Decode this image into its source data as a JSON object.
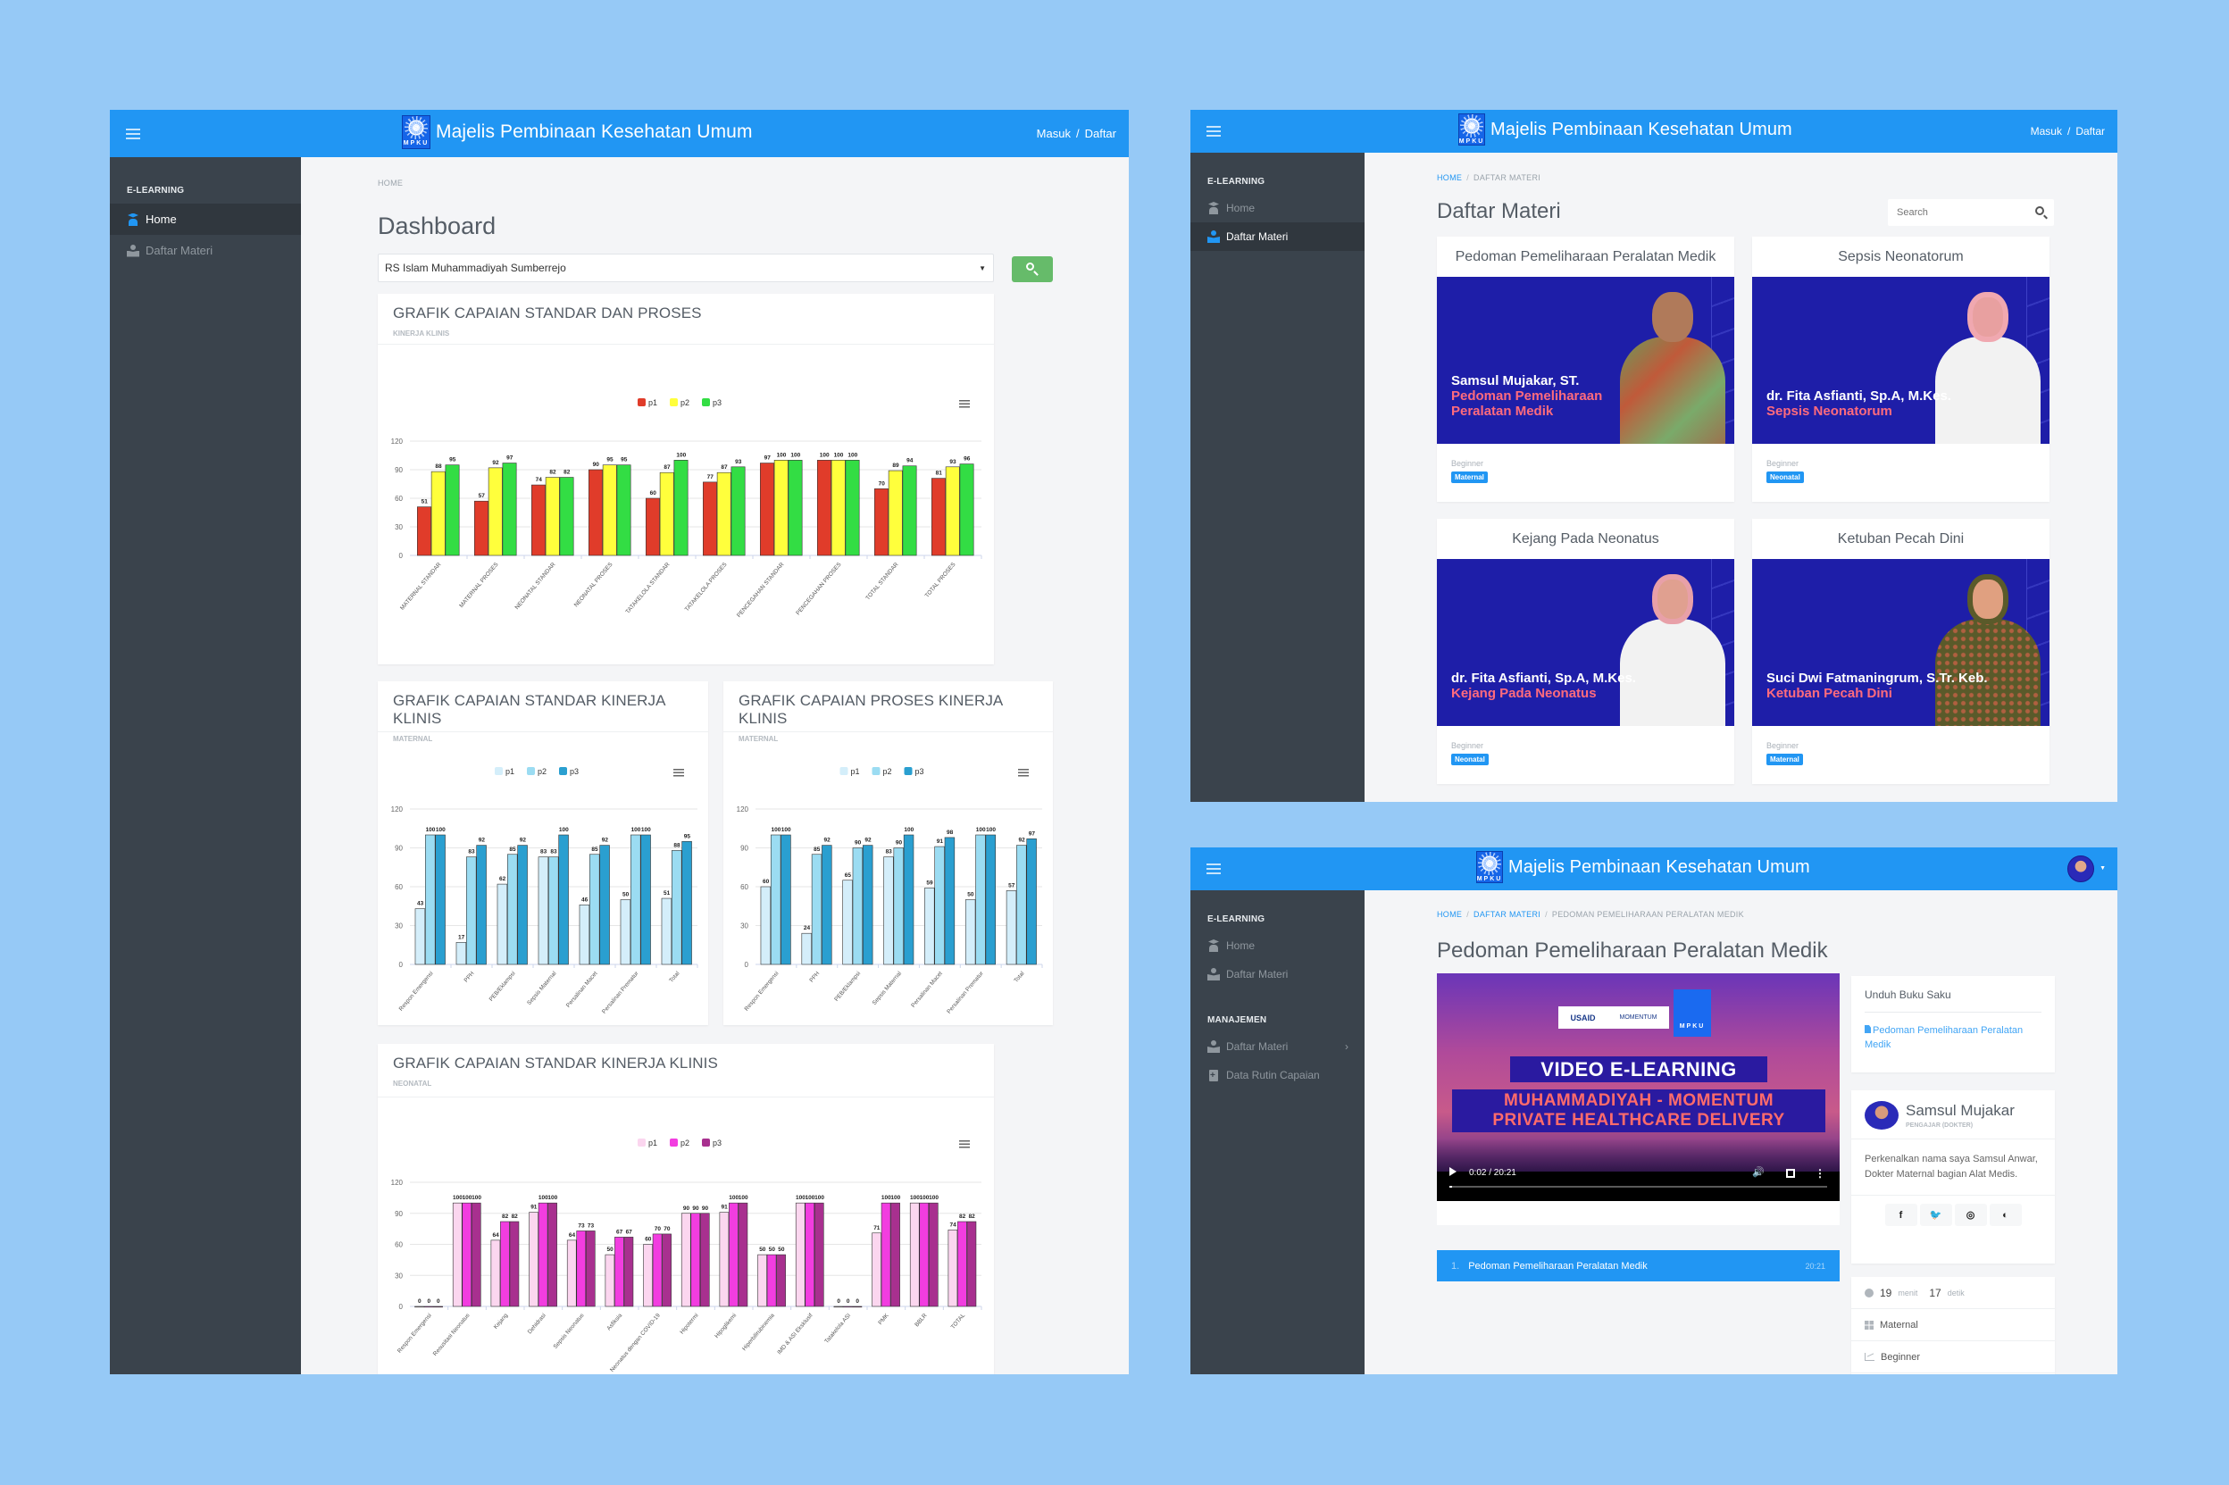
{
  "app": {
    "title": "Majelis Pembinaan Kesehatan Umum",
    "logo_text": "MPKU",
    "login_label": "Masuk",
    "register_label": "Daftar",
    "auth_separator": "/"
  },
  "dashboard": {
    "sidebar": {
      "section": "E-LEARNING",
      "items": [
        {
          "label": "Home",
          "icon": "graduate-icon",
          "active": true
        },
        {
          "label": "Daftar Materi",
          "icon": "book-reader-icon",
          "active": false
        }
      ]
    },
    "breadcrumb": [
      "HOME"
    ],
    "page_title": "Dashboard",
    "hospital_select": {
      "value": "RS Islam Muhammadiyah Sumberrejo"
    },
    "search_button_icon": "search-icon",
    "colors": {
      "primary": "#2196f3",
      "sidebar": "#3a434c",
      "success": "#66bb6a"
    }
  },
  "chart_data": [
    {
      "type": "bar",
      "title": "GRAFIK CAPAIAN STANDAR DAN PROSES",
      "subtitle": "KINERJA KLINIS",
      "categories": [
        "MATERNAL STANDAR",
        "MATERNAL PROSES",
        "NEONATAL STANDAR",
        "NEONATAL PROSES",
        "TATAKELOLA STANDAR",
        "TATAKELOLA PROSES",
        "PENCEGAHAN STANDAR",
        "PENCEGAHAN PROSES",
        "TOTAL STANDAR",
        "TOTAL PROSES"
      ],
      "series": [
        {
          "name": "p1",
          "color": "#e03c2a",
          "values": [
            51,
            57,
            74,
            90,
            60,
            77,
            97,
            100,
            70,
            81
          ]
        },
        {
          "name": "p2",
          "color": "#ffff3c",
          "values": [
            88,
            92,
            82,
            95,
            87,
            87,
            100,
            100,
            89,
            93
          ]
        },
        {
          "name": "p3",
          "color": "#33dd44",
          "values": [
            95,
            97,
            82,
            95,
            100,
            93,
            100,
            100,
            94,
            96
          ]
        }
      ],
      "yticks": [
        0,
        30,
        60,
        90,
        120
      ],
      "ylim": [
        0,
        120
      ],
      "legend": "top-center",
      "grid": true,
      "xlabel": "",
      "ylabel": ""
    },
    {
      "type": "bar",
      "title": "GRAFIK CAPAIAN STANDAR KINERJA KLINIS",
      "subtitle": "MATERNAL",
      "categories": [
        "Respon Emergensi",
        "PPH",
        "PEB/Eklampsi",
        "Sepsis Maternal",
        "Persalinan Macet",
        "Persalinan Prematur",
        "Total"
      ],
      "series": [
        {
          "name": "p1",
          "color": "#d4eefa",
          "values": [
            43,
            17,
            62,
            83,
            46,
            50,
            51
          ]
        },
        {
          "name": "p2",
          "color": "#9bdcf2",
          "values": [
            100,
            83,
            85,
            83,
            85,
            100,
            88
          ]
        },
        {
          "name": "p3",
          "color": "#2a9fd0",
          "values": [
            100,
            92,
            92,
            100,
            92,
            100,
            95
          ]
        }
      ],
      "yticks": [
        0,
        30,
        60,
        90,
        120
      ],
      "ylim": [
        0,
        120
      ],
      "legend": "top-center",
      "grid": true,
      "xlabel": "",
      "ylabel": ""
    },
    {
      "type": "bar",
      "title": "GRAFIK CAPAIAN PROSES KINERJA KLINIS",
      "subtitle": "MATERNAL",
      "categories": [
        "Respon Emergensi",
        "PPH",
        "PEB/Eklampsi",
        "Sepsis Maternal",
        "Persalinan Macet",
        "Persalinan Prematur",
        "Total"
      ],
      "series": [
        {
          "name": "p1",
          "color": "#d4eefa",
          "values": [
            60,
            24,
            65,
            83,
            59,
            50,
            57
          ]
        },
        {
          "name": "p2",
          "color": "#9bdcf2",
          "values": [
            100,
            85,
            90,
            90,
            91,
            100,
            92
          ]
        },
        {
          "name": "p3",
          "color": "#2a9fd0",
          "values": [
            100,
            92,
            92,
            100,
            98,
            100,
            97
          ]
        }
      ],
      "yticks": [
        0,
        30,
        60,
        90,
        120
      ],
      "ylim": [
        0,
        120
      ],
      "legend": "top-center",
      "grid": true,
      "xlabel": "",
      "ylabel": ""
    },
    {
      "type": "bar",
      "title": "GRAFIK CAPAIAN STANDAR KINERJA KLINIS",
      "subtitle": "NEONATAL",
      "categories": [
        "Respon Emergensi",
        "Resusitasi Neonatus",
        "Kejang",
        "Dehidrasi",
        "Sepsis Neonatus",
        "Asfiksia",
        "Neonatus dengan COVID-19",
        "Hipotermi",
        "Hipoglikemi",
        "Hiperbilirubinemia",
        "IMD & ASI Eksklusif",
        "Tatakelola ASI",
        "PMK",
        "BBLR",
        "TOTAL"
      ],
      "series": [
        {
          "name": "p1",
          "color": "#fbd6ef",
          "values": [
            0,
            100,
            64,
            91,
            64,
            50,
            60,
            90,
            91,
            50,
            100,
            0,
            71,
            100,
            74
          ]
        },
        {
          "name": "p2",
          "color": "#f23de0",
          "values": [
            0,
            100,
            82,
            100,
            73,
            67,
            70,
            90,
            100,
            50,
            100,
            0,
            100,
            100,
            82
          ]
        },
        {
          "name": "p3",
          "color": "#a8308f",
          "values": [
            0,
            100,
            82,
            100,
            73,
            67,
            70,
            90,
            100,
            50,
            100,
            0,
            100,
            100,
            82
          ]
        }
      ],
      "yticks": [
        0,
        30,
        60,
        90,
        120
      ],
      "ylim": [
        0,
        120
      ],
      "legend": "top-center",
      "grid": true,
      "xlabel": "",
      "ylabel": ""
    }
  ],
  "materi": {
    "sidebar": {
      "section": "E-LEARNING",
      "items": [
        {
          "label": "Home",
          "active": false
        },
        {
          "label": "Daftar Materi",
          "active": true
        }
      ]
    },
    "breadcrumb": [
      "HOME",
      "DAFTAR MATERI"
    ],
    "page_title": "Daftar Materi",
    "search_placeholder": "Search",
    "courses": [
      {
        "title": "Pedoman Pemeliharaan Peralatan Medik",
        "presenter": "Samsul Mujakar, ST.",
        "subtitle": "Pedoman Pemeliharaan Peralatan Medik",
        "level": "Beginner",
        "category": "Maternal"
      },
      {
        "title": "Sepsis Neonatorum",
        "presenter": "dr. Fita Asfianti, Sp.A, M.Kes.",
        "subtitle": "Sepsis Neonatorum",
        "level": "Beginner",
        "category": "Neonatal"
      },
      {
        "title": "Kejang Pada Neonatus",
        "presenter": "dr. Fita Asfianti, Sp.A, M.Kes.",
        "subtitle": "Kejang Pada Neonatus",
        "level": "Beginner",
        "category": "Neonatal"
      },
      {
        "title": "Ketuban Pecah Dini",
        "presenter": "Suci Dwi Fatmaningrum, S.Tr. Keb.",
        "subtitle": "Ketuban Pecah Dini",
        "level": "Beginner",
        "category": "Maternal"
      }
    ]
  },
  "detail": {
    "sidebar": {
      "sections": [
        {
          "title": "E-LEARNING",
          "items": [
            {
              "label": "Home"
            },
            {
              "label": "Daftar Materi"
            }
          ]
        },
        {
          "title": "MANAJEMEN",
          "items": [
            {
              "label": "Daftar Materi",
              "has_submenu": true
            },
            {
              "label": "Data Rutin Capaian"
            }
          ]
        }
      ]
    },
    "breadcrumb": [
      "HOME",
      "DAFTAR MATERI",
      "PEDOMAN PEMELIHARAAN PERALATAN MEDIK"
    ],
    "page_title": "Pedoman Pemeliharaan Peralatan Medik",
    "video": {
      "heading": "VIDEO E-LEARNING",
      "subheading_1": "MUHAMMADIYAH - MOMENTUM",
      "subheading_2": "PRIVATE HEALTHCARE DELIVERY",
      "partner_1": "USAID",
      "partner_2": "MOMENTUM",
      "time": "0:02 / 20:21",
      "progress": 0.002
    },
    "playlist": [
      {
        "num": "1.",
        "title": "Pedoman Pemeliharaan Peralatan Medik",
        "duration": "20:21"
      }
    ],
    "download": {
      "heading": "Unduh Buku Saku",
      "file_label": "Pedoman Pemeliharaan Peralatan Medik"
    },
    "teacher": {
      "name": "Samsul Mujakar",
      "role": "PENGAJAR (DOKTER)",
      "bio": "Perkenalkan nama saya Samsul Anwar, Dokter Maternal bagian Alat Medis.",
      "social": [
        "facebook",
        "twitter",
        "instagram",
        "github"
      ]
    },
    "info": {
      "minutes": "19",
      "minutes_label": "menit",
      "seconds": "17",
      "seconds_label": "detik",
      "category": "Maternal",
      "level": "Beginner"
    }
  }
}
